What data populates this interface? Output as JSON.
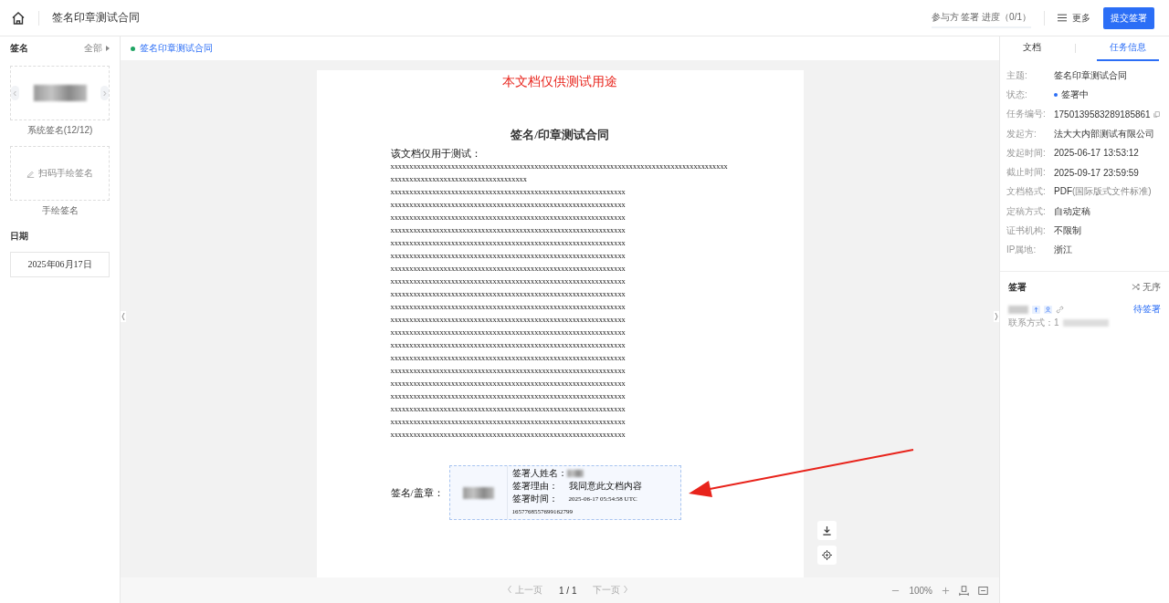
{
  "header": {
    "title": "签名印章测试合同",
    "progress": "参与方 签署 进度（0/1）",
    "more": "更多",
    "submit": "提交签署"
  },
  "sidebar": {
    "signature_title": "签名",
    "all": "全部",
    "system_caption": "系统签名(12/12)",
    "handwrite": "扫码手绘签名",
    "handwrite_caption": "手绘签名",
    "date_title": "日期",
    "date_value": "2025年06月17日"
  },
  "doc_tab": {
    "label": "签名印章测试合同"
  },
  "document": {
    "watermark_note": "本文档仅供测试用途",
    "title": "签名/印章测试合同",
    "intro": "该文档仅用于测试：",
    "lines": [
      "xxxxxxxxxxxxxxxxxxxxxxxxxxxxxxxxxxxxxxxxxxxxxxxxxxxxxxxxxxxxxxxxxxxxxxxxxxxxxxxxxxxxxxxxx",
      "xxxxxxxxxxxxxxxxxxxxxxxxxxxxxxxxxxxx",
      "xxxxxxxxxxxxxxxxxxxxxxxxxxxxxxxxxxxxxxxxxxxxxxxxxxxxxxxxxxxxxx",
      "xxxxxxxxxxxxxxxxxxxxxxxxxxxxxxxxxxxxxxxxxxxxxxxxxxxxxxxxxxxxxx",
      "xxxxxxxxxxxxxxxxxxxxxxxxxxxxxxxxxxxxxxxxxxxxxxxxxxxxxxxxxxxxxx",
      "xxxxxxxxxxxxxxxxxxxxxxxxxxxxxxxxxxxxxxxxxxxxxxxxxxxxxxxxxxxxxx",
      "xxxxxxxxxxxxxxxxxxxxxxxxxxxxxxxxxxxxxxxxxxxxxxxxxxxxxxxxxxxxxx",
      "xxxxxxxxxxxxxxxxxxxxxxxxxxxxxxxxxxxxxxxxxxxxxxxxxxxxxxxxxxxxxx",
      "xxxxxxxxxxxxxxxxxxxxxxxxxxxxxxxxxxxxxxxxxxxxxxxxxxxxxxxxxxxxxx",
      "xxxxxxxxxxxxxxxxxxxxxxxxxxxxxxxxxxxxxxxxxxxxxxxxxxxxxxxxxxxxxx",
      "xxxxxxxxxxxxxxxxxxxxxxxxxxxxxxxxxxxxxxxxxxxxxxxxxxxxxxxxxxxxxx",
      "xxxxxxxxxxxxxxxxxxxxxxxxxxxxxxxxxxxxxxxxxxxxxxxxxxxxxxxxxxxxxx",
      "xxxxxxxxxxxxxxxxxxxxxxxxxxxxxxxxxxxxxxxxxxxxxxxxxxxxxxxxxxxxxx",
      "xxxxxxxxxxxxxxxxxxxxxxxxxxxxxxxxxxxxxxxxxxxxxxxxxxxxxxxxxxxxxx",
      "xxxxxxxxxxxxxxxxxxxxxxxxxxxxxxxxxxxxxxxxxxxxxxxxxxxxxxxxxxxxxx",
      "xxxxxxxxxxxxxxxxxxxxxxxxxxxxxxxxxxxxxxxxxxxxxxxxxxxxxxxxxxxxxx",
      "xxxxxxxxxxxxxxxxxxxxxxxxxxxxxxxxxxxxxxxxxxxxxxxxxxxxxxxxxxxxxx",
      "xxxxxxxxxxxxxxxxxxxxxxxxxxxxxxxxxxxxxxxxxxxxxxxxxxxxxxxxxxxxxx",
      "xxxxxxxxxxxxxxxxxxxxxxxxxxxxxxxxxxxxxxxxxxxxxxxxxxxxxxxxxxxxxx",
      "xxxxxxxxxxxxxxxxxxxxxxxxxxxxxxxxxxxxxxxxxxxxxxxxxxxxxxxxxxxxxx",
      "xxxxxxxxxxxxxxxxxxxxxxxxxxxxxxxxxxxxxxxxxxxxxxxxxxxxxxxxxxxxxx",
      "xxxxxxxxxxxxxxxxxxxxxxxxxxxxxxxxxxxxxxxxxxxxxxxxxxxxxxxxxxxxxx"
    ],
    "sign_label": "签名/盖章：",
    "stamp": {
      "name_label": "签署人姓名：",
      "reason_label": "签署理由：",
      "reason": "我同意此文档内容",
      "time_label": "签署时间：",
      "time": "2025-06-17 05:54:58 UTC",
      "code": "1657768557699162799"
    }
  },
  "pager": {
    "prev": "上一页",
    "page": "1 / 1",
    "next": "下一页",
    "zoom": "100%"
  },
  "right_tabs": [
    {
      "label": "文档",
      "selected": false
    },
    {
      "label": "任务信息",
      "selected": true
    }
  ],
  "info": [
    {
      "label": "主题:",
      "value": "签名印章测试合同"
    },
    {
      "label": "状态:",
      "value": "签署中",
      "kind": "status",
      "color": "#2b6ef6"
    },
    {
      "label": "任务编号:",
      "value": "1750139583289185861",
      "kind": "copy"
    },
    {
      "label": "发起方:",
      "value": "法大大内部测试有限公司"
    },
    {
      "label": "发起时间:",
      "value": "2025-06-17 13:53:12"
    },
    {
      "label": "截止时间:",
      "value": "2025-09-17 23:59:59"
    },
    {
      "label": "文档格式:",
      "value": "PDF",
      "note": "(国际版式文件标准)"
    },
    {
      "label": "定稿方式:",
      "value": "自动定稿"
    },
    {
      "label": "证书机构:",
      "value": "不限制"
    },
    {
      "label": "IP属地:",
      "value": "浙江"
    }
  ],
  "signers": {
    "title": "签署",
    "order": "无序",
    "status": "待签署",
    "contact_label": "联系方式：",
    "contact_visible": "1"
  }
}
